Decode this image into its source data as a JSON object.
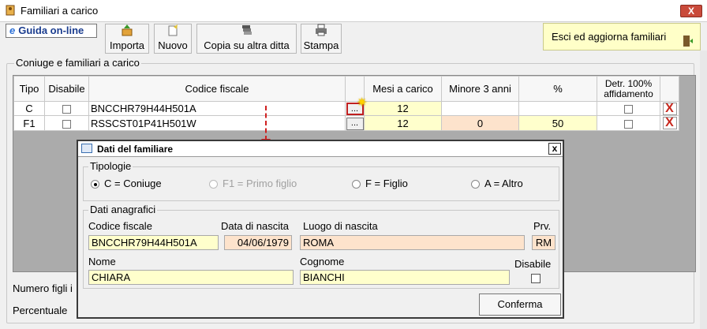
{
  "window": {
    "title": "Familiari a carico",
    "close_label": "X"
  },
  "toolbar": {
    "help_label": "Guida on-line",
    "help_glyph": "e",
    "buttons": [
      {
        "label": "Importa",
        "icon": "import-icon"
      },
      {
        "label": "Nuovo",
        "icon": "new-icon"
      },
      {
        "label": "Copia su altra ditta",
        "icon": "copy-icon"
      },
      {
        "label": "Stampa",
        "icon": "print-icon"
      }
    ],
    "exit_label": "Esci ed aggiorna familiari"
  },
  "group_title": "Coniuge e familiari a carico",
  "grid": {
    "columns": [
      "Tipo",
      "Disabile",
      "Codice fiscale",
      "",
      "Mesi a carico",
      "Minore 3 anni",
      "%",
      "Detr. 100% affidamento",
      ""
    ],
    "rows": [
      {
        "tipo": "C",
        "codice": "BNCCHR79H44H501A",
        "mesi": "12",
        "minore": "",
        "perc": "",
        "ellipsis": "..."
      },
      {
        "tipo": "F1",
        "codice": "RSSCST01P41H501W",
        "mesi": "12",
        "minore": "0",
        "perc": "50",
        "ellipsis": "..."
      }
    ],
    "delete_glyph": "X"
  },
  "bottom_labels": {
    "num_figli": "Numero figli i",
    "percentuale": "Percentuale"
  },
  "dialog": {
    "title": "Dati del familiare",
    "close_label": "x",
    "tipologie": {
      "legend": "Tipologie",
      "options": [
        {
          "label": "C = Coniuge",
          "selected": true,
          "enabled": true
        },
        {
          "label": "F1 = Primo figlio",
          "selected": false,
          "enabled": false
        },
        {
          "label": "F = Figlio",
          "selected": false,
          "enabled": true
        },
        {
          "label": "A = Altro",
          "selected": false,
          "enabled": true
        }
      ]
    },
    "anagrafici": {
      "legend": "Dati anagrafici",
      "codice_fiscale_label": "Codice fiscale",
      "codice_fiscale": "BNCCHR79H44H501A",
      "data_nascita_label": "Data di nascita",
      "data_nascita": "04/06/1979",
      "luogo_nascita_label": "Luogo di nascita",
      "luogo_nascita": "ROMA",
      "prv_label": "Prv.",
      "prv": "RM",
      "nome_label": "Nome",
      "nome": "CHIARA",
      "cognome_label": "Cognome",
      "cognome": "BIANCHI",
      "disabile_label": "Disabile",
      "disabile": false
    },
    "confirm_label": "Conferma"
  },
  "colors": {
    "yellow_field": "#ffffcc",
    "salmon_field": "#fde3cc",
    "exit_button": "#ffffc8",
    "delete_red": "#c8281e"
  }
}
